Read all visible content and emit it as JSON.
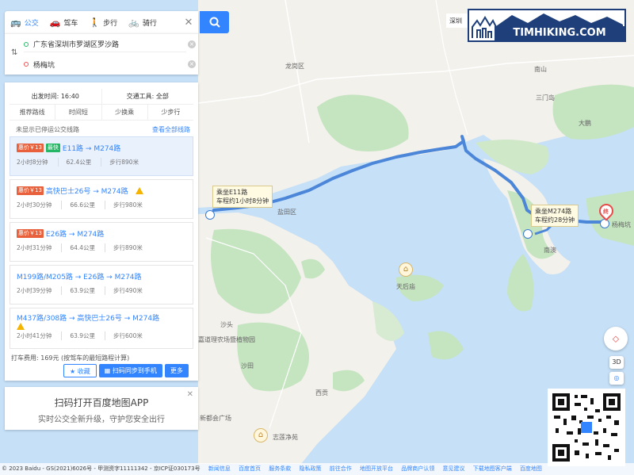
{
  "modes": [
    {
      "icon": "bus-icon",
      "label": "公交",
      "active": true
    },
    {
      "icon": "car-icon",
      "label": "驾车",
      "active": false
    },
    {
      "icon": "walk-icon",
      "label": "步行",
      "active": false
    },
    {
      "icon": "bike-icon",
      "label": "骑行",
      "active": false
    }
  ],
  "start": "广东省深圳市罗湖区罗沙路",
  "end": "杨梅坑",
  "departure": "出发时间: 16:40",
  "transport_tool": "交通工具: 全部",
  "tabs": [
    "推荐路线",
    "时间短",
    "少换乘",
    "少步行"
  ],
  "notice": "未显示已停运公交线路",
  "view_all": "查看全部线路",
  "routes": [
    {
      "tags": [
        "惠价￥13",
        "最快"
      ],
      "title": "E11路 → M274路",
      "time": "2小时8分钟",
      "dist": "62.4公里",
      "walk": "步行890米",
      "warn": false
    },
    {
      "tags": [
        "惠价￥13"
      ],
      "title": "高快巴士26号 → M274路",
      "time": "2小时30分钟",
      "dist": "66.6公里",
      "walk": "步行980米",
      "warn": true
    },
    {
      "tags": [
        "惠价￥13"
      ],
      "title": "E26路 → M274路",
      "time": "2小时31分钟",
      "dist": "64.4公里",
      "walk": "步行890米",
      "warn": false
    },
    {
      "tags": [],
      "title": "M199路/M205路 → E26路 → M274路",
      "time": "2小时39分钟",
      "dist": "63.9公里",
      "walk": "步行490米",
      "warn": false
    },
    {
      "tags": [],
      "title": "M437路/308路 → 高快巴士26号 → M274路",
      "time": "2小时41分钟",
      "dist": "63.9公里",
      "walk": "步行600米",
      "warn": true
    }
  ],
  "taxi_fare": "打车费用: 169元 (按驾车的最短路程计算)",
  "btn_fav": "收藏",
  "btn_scan": "扫码同步到手机",
  "btn_more": "更多",
  "app_title": "扫码打开百度地图APP",
  "app_sub": "实时公交全新升级，守护您安全出行",
  "callout1": [
    "乘坐E11路",
    "车程约1小时8分钟"
  ],
  "callout2": [
    "乘坐M274路",
    "车程约28分钟"
  ],
  "pin_label": "终",
  "dest_label": "杨梅坑",
  "logo": "TIMHIKING.COM",
  "search_stub": "深圳",
  "map_labels": {
    "longgang": "龙岗区",
    "nanao": "南澳",
    "dapeng": "大鹏",
    "sanmen": "三门岛",
    "yantian": "盐田区",
    "tianhou": "天后庙",
    "xigong": "西贡",
    "sheung": "沙头",
    "farm": "嘉道理农场暨植物园",
    "chevalier": "志莲净苑",
    "jordan": "新都会广场",
    "shatin": "沙田",
    "nanshan": "南山"
  },
  "ctrl_3d": "3D",
  "footer_copy": "© 2023 Baidu - GS(2021)6026号 - 甲测资字11111342 - 京ICP证030173号",
  "footer_links": [
    "新闻信息",
    "百度首页",
    "服务条款",
    "隐私政策",
    "前往合作",
    "地图开放平台",
    "品牌商户认领",
    "意见建议",
    "下载地图客户端",
    "百度地图"
  ],
  "colors": {
    "accent": "#3385ff",
    "route": "#4b86d8",
    "land": "#f3f1ec",
    "green": "#c5e4c0",
    "water": "#c6e0f7"
  }
}
